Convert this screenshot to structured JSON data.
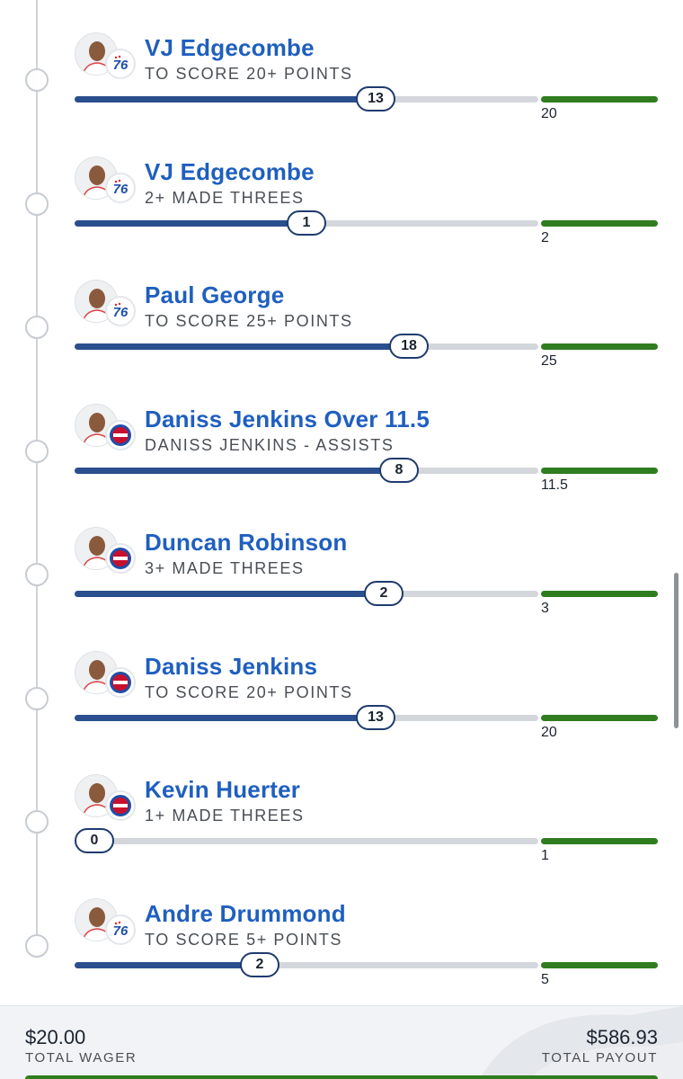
{
  "colors": {
    "accent_blue": "#1f5fbf",
    "progress_fill": "#2b4f8e",
    "target_green": "#2f7d1f",
    "track_gray": "#d3d7db"
  },
  "legs": [
    {
      "player": "VJ Edgecombe",
      "market": "TO SCORE 20+ POINTS",
      "current": 13,
      "target": "20",
      "team": "76ers",
      "progress": 0.65
    },
    {
      "player": "VJ Edgecombe",
      "market": "2+ MADE THREES",
      "current": 1,
      "target": "2",
      "team": "76ers",
      "progress": 0.5
    },
    {
      "player": "Paul George",
      "market": "TO SCORE 25+ POINTS",
      "current": 18,
      "target": "25",
      "team": "76ers",
      "progress": 0.72
    },
    {
      "player": "Daniss Jenkins Over 11.5",
      "market": "DANISS JENKINS - ASSISTS",
      "current": 8,
      "target": "11.5",
      "team": "Pistons",
      "progress": 0.7
    },
    {
      "player": "Duncan Robinson",
      "market": "3+ MADE THREES",
      "current": 2,
      "target": "3",
      "team": "Pistons",
      "progress": 0.667
    },
    {
      "player": "Daniss Jenkins",
      "market": "TO SCORE 20+ POINTS",
      "current": 13,
      "target": "20",
      "team": "Pistons",
      "progress": 0.65
    },
    {
      "player": "Kevin Huerter",
      "market": "1+ MADE THREES",
      "current": 0,
      "target": "1",
      "team": "Pistons",
      "progress": 0.0
    },
    {
      "player": "Andre Drummond",
      "market": "TO SCORE 5+ POINTS",
      "current": 2,
      "target": "5",
      "team": "76ers",
      "progress": 0.4
    }
  ],
  "footer": {
    "wager_amount": "$20.00",
    "wager_label": "TOTAL WAGER",
    "payout_amount": "$586.93",
    "payout_label": "TOTAL PAYOUT"
  }
}
